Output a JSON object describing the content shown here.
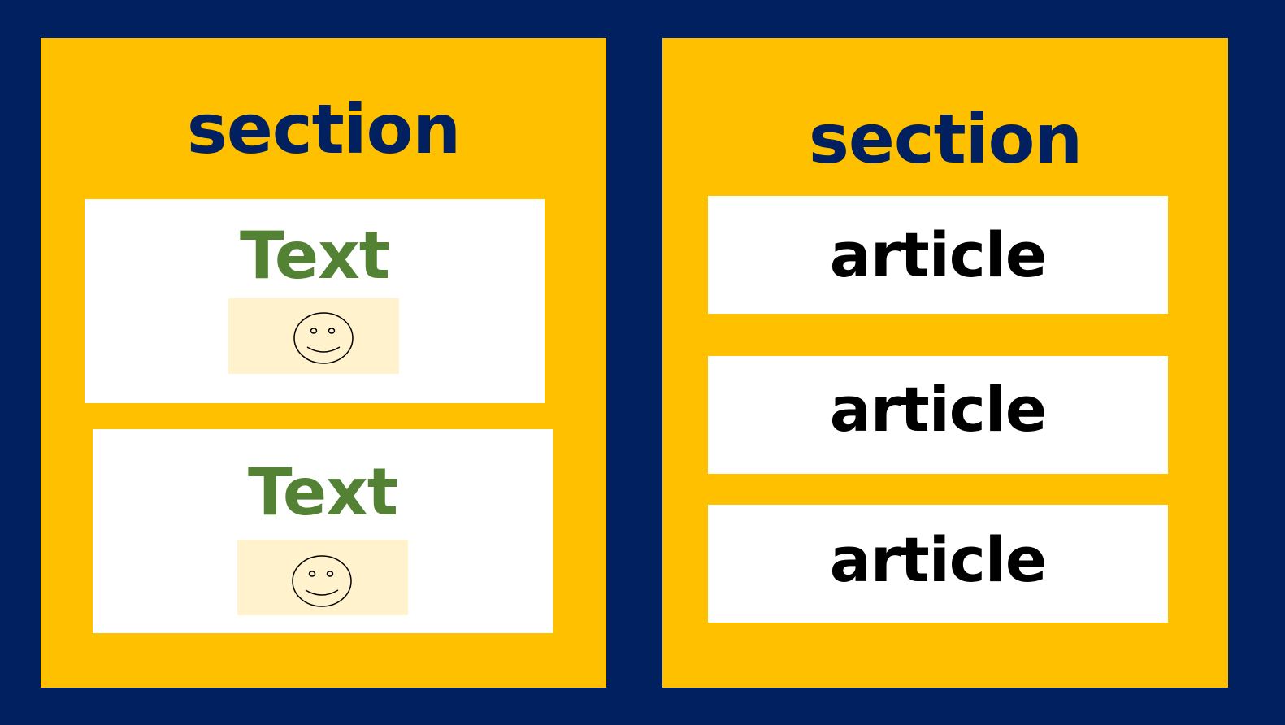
{
  "colors": {
    "background": "#002060",
    "section": "#FFC000",
    "box": "#FFFFFF",
    "smiley_panel": "#FFF2CC",
    "text_green": "#548235",
    "article_text": "#000000"
  },
  "left_section": {
    "title": "section",
    "cards": [
      {
        "label": "Text",
        "icon": "smiley-face-icon"
      },
      {
        "label": "Text",
        "icon": "smiley-face-icon"
      }
    ]
  },
  "right_section": {
    "title": "section",
    "articles": [
      {
        "label": "article"
      },
      {
        "label": "article"
      },
      {
        "label": "article"
      }
    ]
  }
}
